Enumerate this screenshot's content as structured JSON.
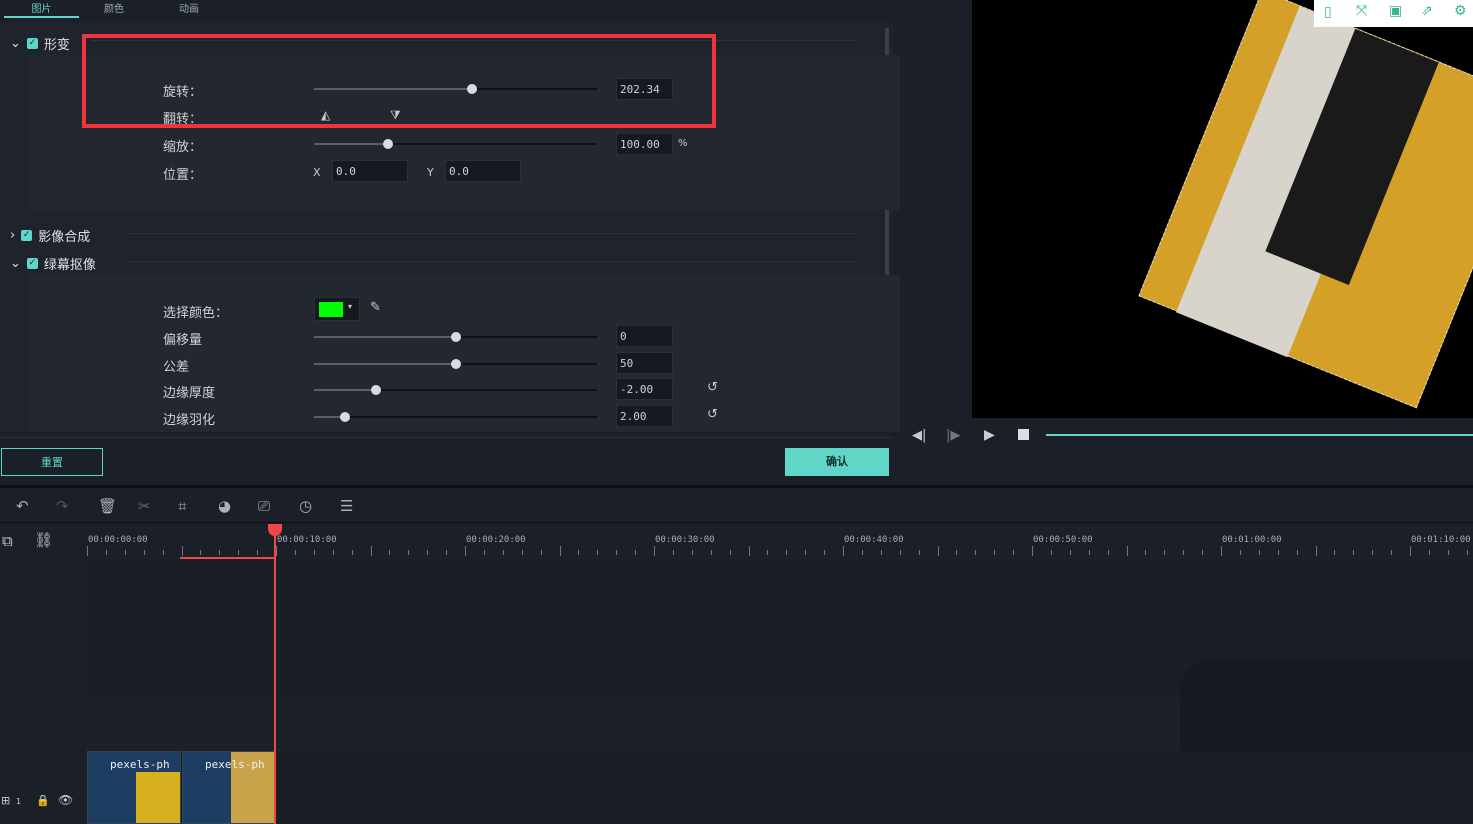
{
  "tabs": [
    {
      "label": "图片",
      "active": true
    },
    {
      "label": "颜色"
    },
    {
      "label": "动画"
    }
  ],
  "transform": {
    "title": "形变",
    "rotate_label": "旋转：",
    "rotate_value": "202.34",
    "rotate_fraction": 0.56,
    "flip_label": "翻转：",
    "scale_label": "缩放：",
    "scale_value": "100.00",
    "scale_unit": "%",
    "scale_fraction": 0.26,
    "position_label": "位置：",
    "x_label": "X",
    "x_value": "0.0",
    "y_label": "Y",
    "y_value": "0.0"
  },
  "compositing": {
    "title": "影像合成"
  },
  "chroma": {
    "title": "绿幕抠像",
    "color_label": "选择颜色：",
    "color": "#00ff00",
    "rows": [
      {
        "label": "偏移量",
        "value": "0",
        "fraction": 0.5
      },
      {
        "label": "公差",
        "value": "50",
        "fraction": 0.5
      },
      {
        "label": "边缘厚度",
        "value": "-2.00",
        "fraction": 0.22,
        "reset": true
      },
      {
        "label": "边缘羽化",
        "value": "2.00",
        "fraction": 0.11,
        "reset": true
      }
    ]
  },
  "buttons": {
    "reset": "重置",
    "ok": "确认"
  },
  "accent": "#5fd6c8",
  "ruler": [
    "00:00:00:00",
    "00:00:10:00",
    "00:00:20:00",
    "00:00:30:00",
    "00:00:40:00",
    "00:00:50:00",
    "00:01:00:00",
    "00:01:10:00"
  ],
  "clips": [
    {
      "name": "pexels-ph"
    },
    {
      "name": "pexels-ph"
    }
  ],
  "track": {
    "number": "1"
  }
}
